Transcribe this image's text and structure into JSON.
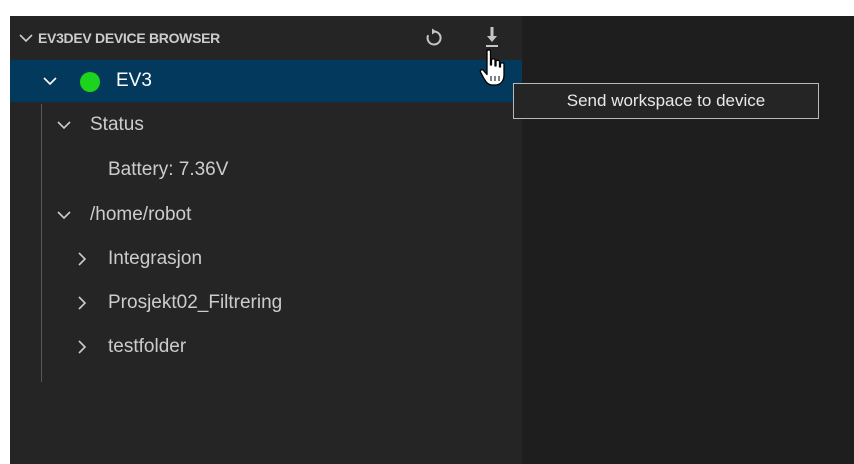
{
  "view": {
    "title": "EV3DEV DEVICE BROWSER",
    "actions": {
      "refresh_icon": "refresh-icon",
      "send_icon": "download-arrow-icon",
      "send_tooltip": "Send workspace to device"
    }
  },
  "tree": {
    "device": {
      "label": "EV3",
      "status_color": "#1bd41b",
      "expanded": true
    },
    "status": {
      "label": "Status",
      "battery": "Battery: 7.36V"
    },
    "folder": {
      "label": "/home/robot",
      "children": [
        "Integrasjon",
        "Prosjekt02_Filtrering",
        "testfolder"
      ]
    }
  },
  "colors": {
    "sidebar_background": "#252526",
    "editor_background": "#1e1e1e",
    "selection": "#04395e",
    "text": "#cccccc"
  }
}
